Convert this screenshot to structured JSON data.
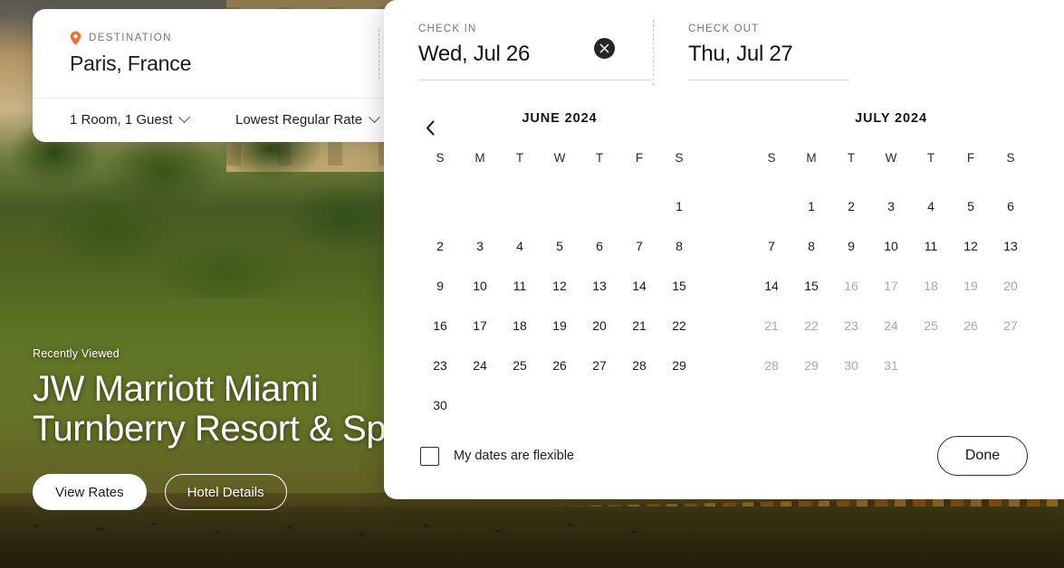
{
  "hero": {
    "kicker": "Recently Viewed",
    "title": "JW Marriott Miami\nTurnberry Resort & Spa",
    "view_rates_label": "View Rates",
    "hotel_details_label": "Hotel Details"
  },
  "search": {
    "destination_label": "DESTINATION",
    "destination_value": "Paris, France",
    "pin_icon": "map-pin-icon",
    "pin_color": "#e8743b",
    "occupancy_value": "1 Room, 1 Guest",
    "rate_value": "Lowest Regular Rate"
  },
  "datepicker": {
    "checkin": {
      "label": "CHECK IN",
      "value": "Wed, Jul 26",
      "clear_icon": "close-icon"
    },
    "checkout": {
      "label": "CHECK OUT",
      "value": "Thu, Jul 27"
    },
    "prev_icon": "chevron-left-icon",
    "weekdays": [
      "S",
      "M",
      "T",
      "W",
      "T",
      "F",
      "S"
    ],
    "months": [
      {
        "title": "JUNE 2024",
        "lead_blanks": 6,
        "days": [
          {
            "n": 1,
            "disabled": false
          },
          {
            "n": 2,
            "disabled": false
          },
          {
            "n": 3,
            "disabled": false
          },
          {
            "n": 4,
            "disabled": false
          },
          {
            "n": 5,
            "disabled": false
          },
          {
            "n": 6,
            "disabled": false
          },
          {
            "n": 7,
            "disabled": false
          },
          {
            "n": 8,
            "disabled": false
          },
          {
            "n": 9,
            "disabled": false
          },
          {
            "n": 10,
            "disabled": false
          },
          {
            "n": 11,
            "disabled": false
          },
          {
            "n": 12,
            "disabled": false
          },
          {
            "n": 13,
            "disabled": false
          },
          {
            "n": 14,
            "disabled": false
          },
          {
            "n": 15,
            "disabled": false
          },
          {
            "n": 16,
            "disabled": false
          },
          {
            "n": 17,
            "disabled": false
          },
          {
            "n": 18,
            "disabled": false
          },
          {
            "n": 19,
            "disabled": false
          },
          {
            "n": 20,
            "disabled": false
          },
          {
            "n": 21,
            "disabled": false
          },
          {
            "n": 22,
            "disabled": false
          },
          {
            "n": 23,
            "disabled": false
          },
          {
            "n": 24,
            "disabled": false
          },
          {
            "n": 25,
            "disabled": false
          },
          {
            "n": 26,
            "disabled": false
          },
          {
            "n": 27,
            "disabled": false
          },
          {
            "n": 28,
            "disabled": false
          },
          {
            "n": 29,
            "disabled": false
          },
          {
            "n": 30,
            "disabled": false
          }
        ]
      },
      {
        "title": "JULY 2024",
        "lead_blanks": 1,
        "days": [
          {
            "n": 1,
            "disabled": false
          },
          {
            "n": 2,
            "disabled": false
          },
          {
            "n": 3,
            "disabled": false
          },
          {
            "n": 4,
            "disabled": false
          },
          {
            "n": 5,
            "disabled": false
          },
          {
            "n": 6,
            "disabled": false
          },
          {
            "n": 7,
            "disabled": false
          },
          {
            "n": 8,
            "disabled": false
          },
          {
            "n": 9,
            "disabled": false
          },
          {
            "n": 10,
            "disabled": false
          },
          {
            "n": 11,
            "disabled": false
          },
          {
            "n": 12,
            "disabled": false
          },
          {
            "n": 13,
            "disabled": false
          },
          {
            "n": 14,
            "disabled": false
          },
          {
            "n": 15,
            "disabled": false
          },
          {
            "n": 16,
            "disabled": true
          },
          {
            "n": 17,
            "disabled": true
          },
          {
            "n": 18,
            "disabled": true
          },
          {
            "n": 19,
            "disabled": true
          },
          {
            "n": 20,
            "disabled": true
          },
          {
            "n": 21,
            "disabled": true
          },
          {
            "n": 22,
            "disabled": true
          },
          {
            "n": 23,
            "disabled": true
          },
          {
            "n": 24,
            "disabled": true
          },
          {
            "n": 25,
            "disabled": true
          },
          {
            "n": 26,
            "disabled": true
          },
          {
            "n": 27,
            "disabled": true
          },
          {
            "n": 28,
            "disabled": true
          },
          {
            "n": 29,
            "disabled": true
          },
          {
            "n": 30,
            "disabled": true
          },
          {
            "n": 31,
            "disabled": true
          }
        ]
      }
    ],
    "flexible_label": "My dates are flexible",
    "flexible_checked": false,
    "done_label": "Done"
  }
}
